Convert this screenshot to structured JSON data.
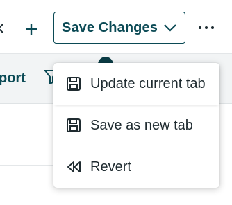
{
  "toolbar": {
    "save_changes_label": "Save Changes",
    "plus_glyph": "+",
    "icons": [
      "chevron-left-icon",
      "plus-icon",
      "chevron-down-icon",
      "more-options-icon"
    ]
  },
  "subbar": {
    "export_label_partial": "port",
    "icons": [
      "filter-icon"
    ]
  },
  "menu": {
    "items": [
      {
        "label": "Update current tab",
        "icon": "save-icon"
      },
      {
        "label": "Save as new tab",
        "icon": "save-icon"
      },
      {
        "label": "Revert",
        "icon": "rewind-icon"
      }
    ]
  },
  "colors": {
    "brand_teal": "#0b4a55",
    "menu_text": "#1f2b30",
    "background": "#ffffff"
  }
}
